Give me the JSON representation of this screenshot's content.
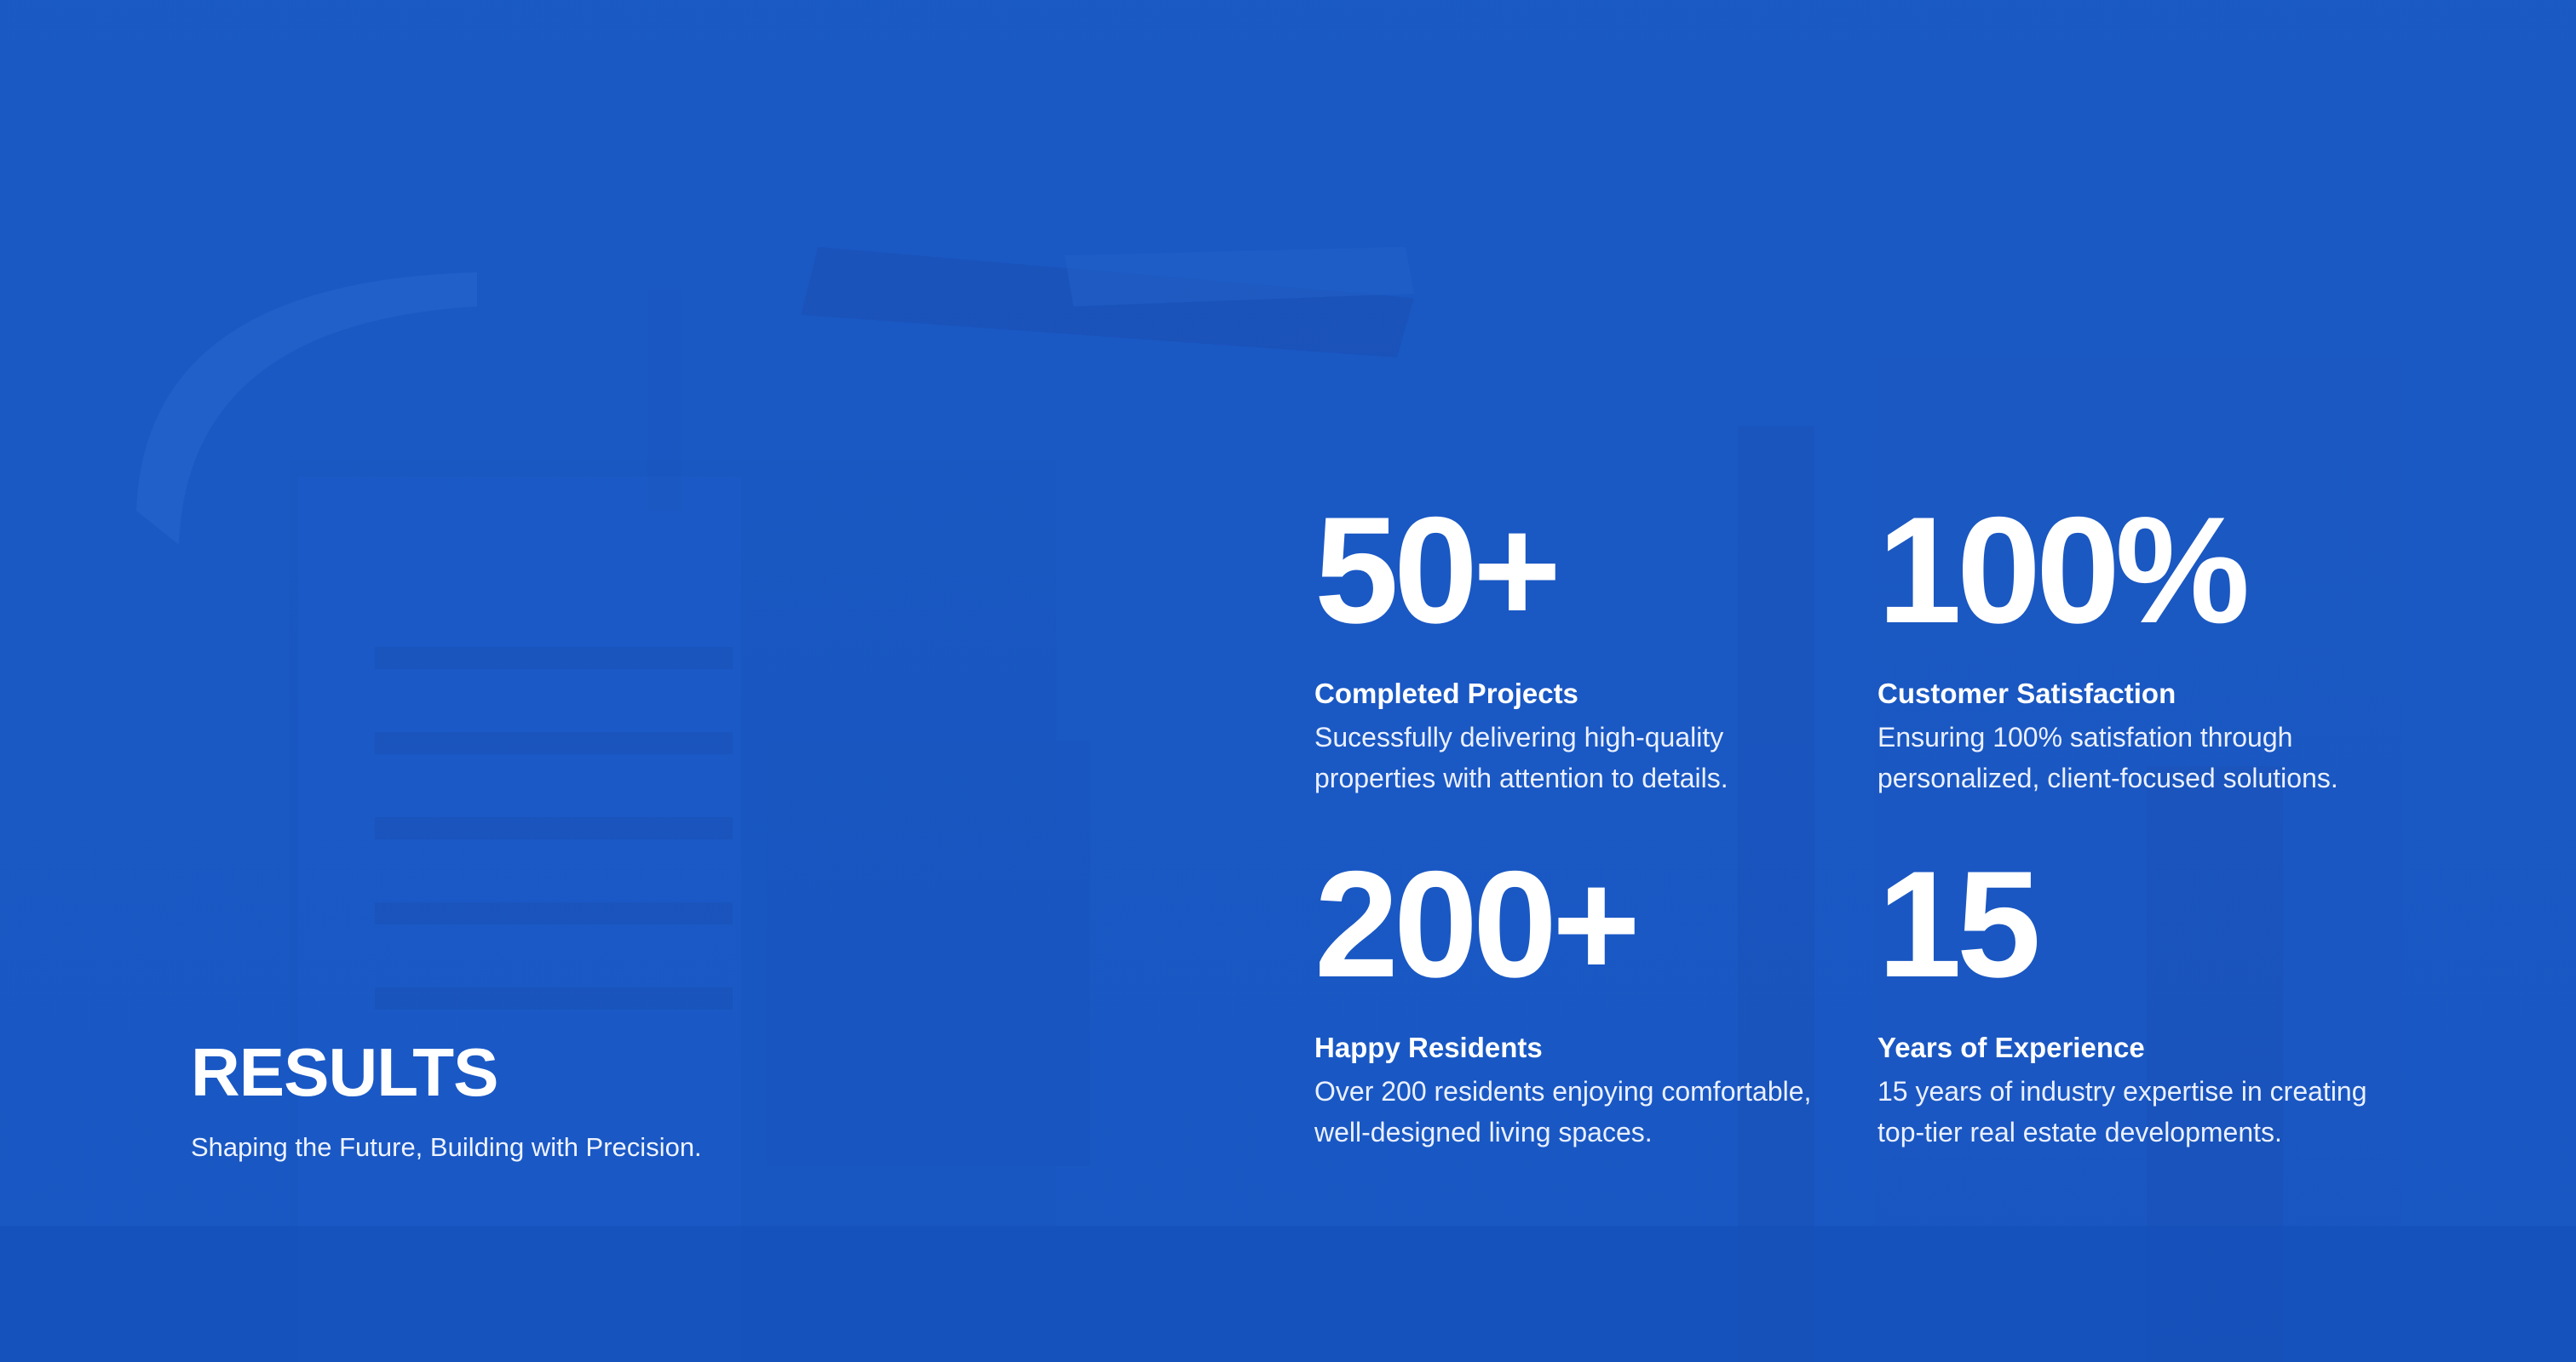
{
  "results": {
    "title": "RESULTS",
    "subtitle": "Shaping the Future, Building with Precision.",
    "background_color": "#1855c2",
    "background_image": "building-silhouette"
  },
  "stats": [
    {
      "value": "50+",
      "label": "Completed Projects",
      "description": "Sucessfully delivering high-quality properties with attention to details."
    },
    {
      "value": "100%",
      "label": "Customer Satisfaction",
      "description": "Ensuring 100% satisfation through personalized, client-focused solutions."
    },
    {
      "value": "200+",
      "label": "Happy Residents",
      "description": "Over 200 residents enjoying comfortable, well-designed living spaces."
    },
    {
      "value": "15",
      "label": "Years of Experience",
      "description": "15 years of industry expertise in creating top-tier real estate developments."
    }
  ]
}
